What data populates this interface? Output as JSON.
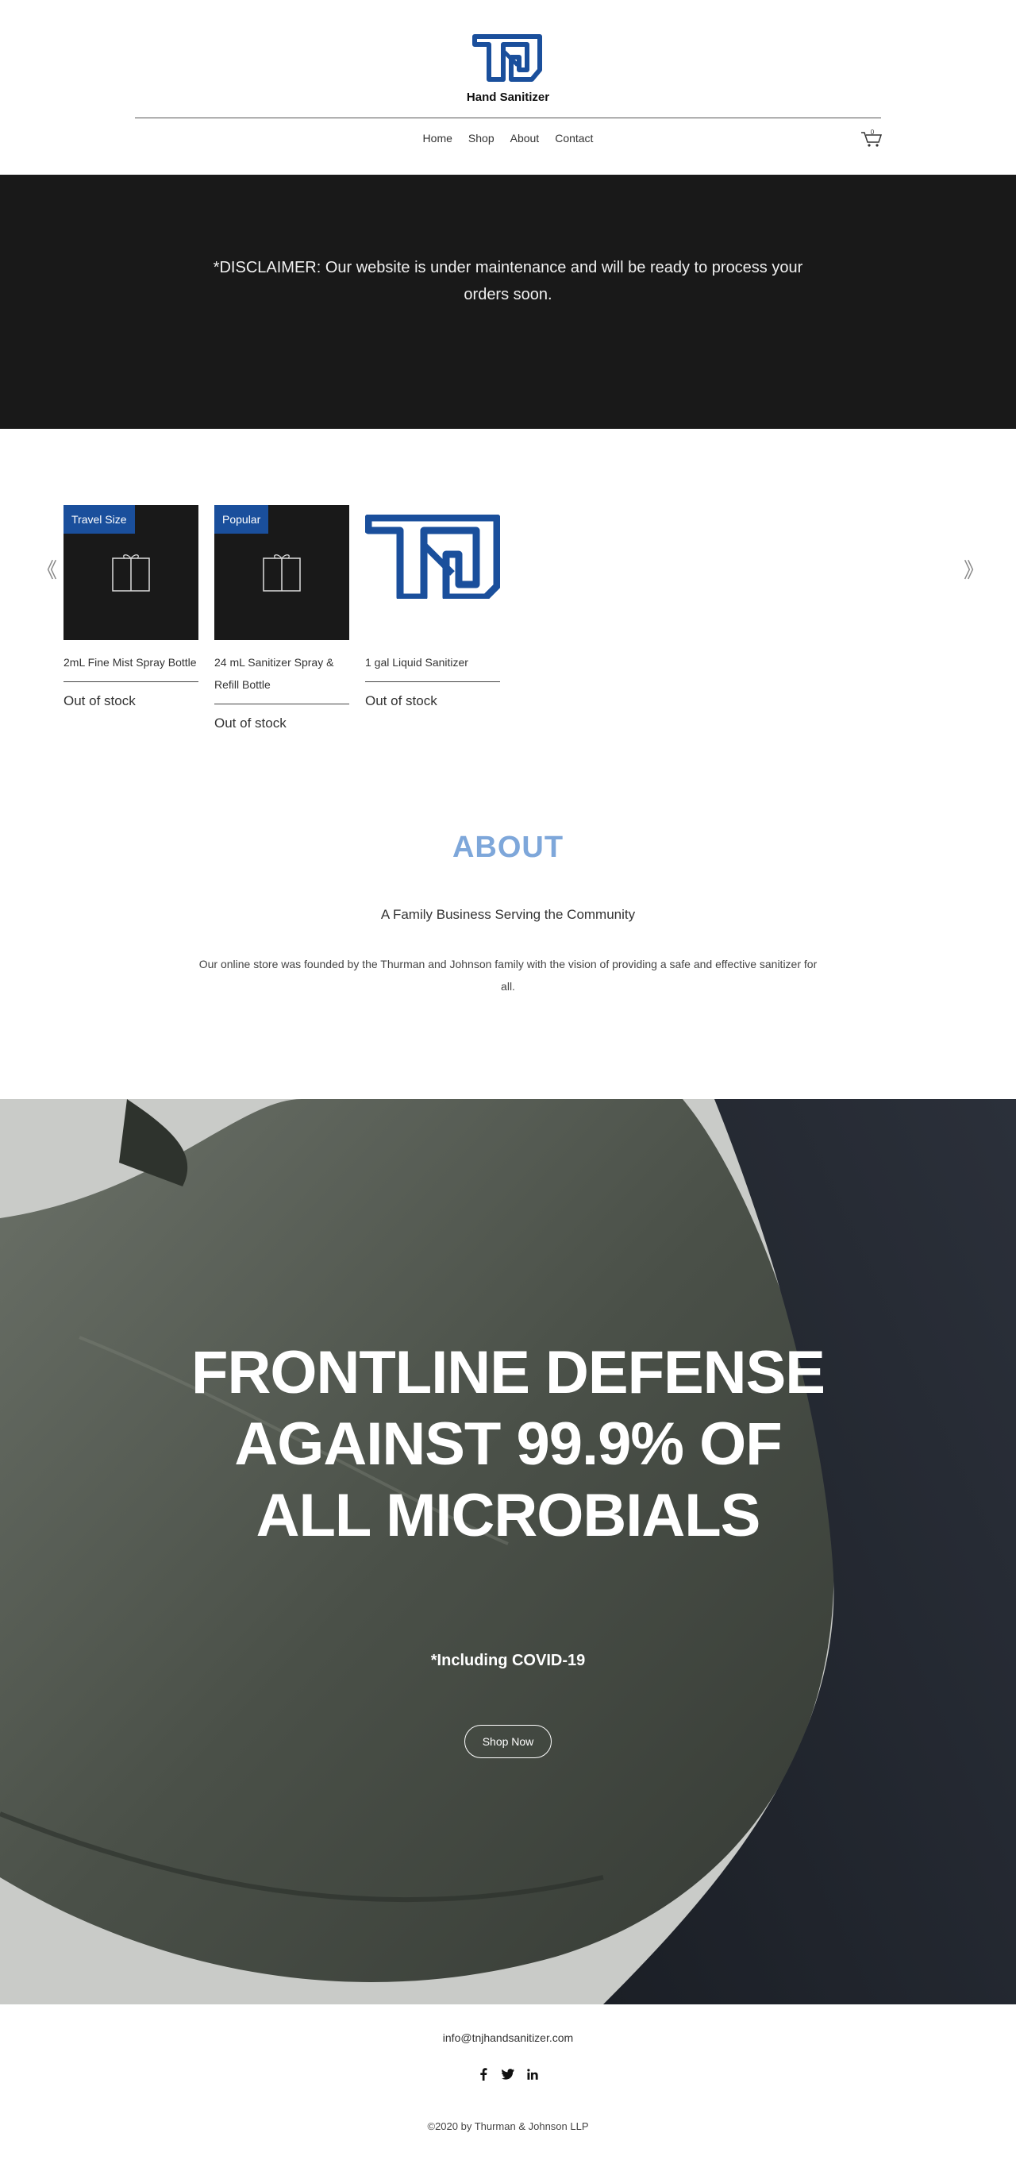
{
  "header": {
    "brand_name": "Hand Sanitizer",
    "logo_text": "TNJ",
    "nav": [
      "Home",
      "Shop",
      "About",
      "Contact"
    ],
    "cart_count": "0",
    "logo_color": "#1a4f9c"
  },
  "disclaimer": {
    "text": "*DISCLAIMER: Our website is under maintenance and will be ready to process your orders soon."
  },
  "products": [
    {
      "ribbon": "Travel Size",
      "name": "2mL Fine Mist Spray Bottle",
      "status": "Out of stock",
      "image": "gift-icon"
    },
    {
      "ribbon": "Popular",
      "name": "24 mL Sanitizer Spray & Refill Bottle",
      "status": "Out of stock",
      "image": "gift-icon"
    },
    {
      "ribbon": "",
      "name": "1 gal Liquid Sanitizer",
      "status": "Out of stock",
      "image": "tnj-logo"
    }
  ],
  "gallery": {
    "prev_arrow": "《",
    "next_arrow": "》"
  },
  "about": {
    "title": "ABOUT",
    "subtitle": "A Family Business Serving the Community",
    "body": "Our online store was founded by the Thurman and Johnson family with the vision of providing a safe and effective sanitizer for all."
  },
  "hero": {
    "title": "FRONTLINE DEFENSE AGAINST 99.9% OF ALL MICROBIALS",
    "note": "*Including COVID-19",
    "button": "Shop Now"
  },
  "footer": {
    "email": "info@tnjhandsanitizer.com",
    "socials": [
      "facebook-icon",
      "twitter-icon",
      "linkedin-icon"
    ],
    "copyright": "©2020 by Thurman & Johnson LLP"
  },
  "colors": {
    "accent": "#1a4f9c",
    "about_title": "#7ea7da",
    "dark_band": "#191919"
  }
}
